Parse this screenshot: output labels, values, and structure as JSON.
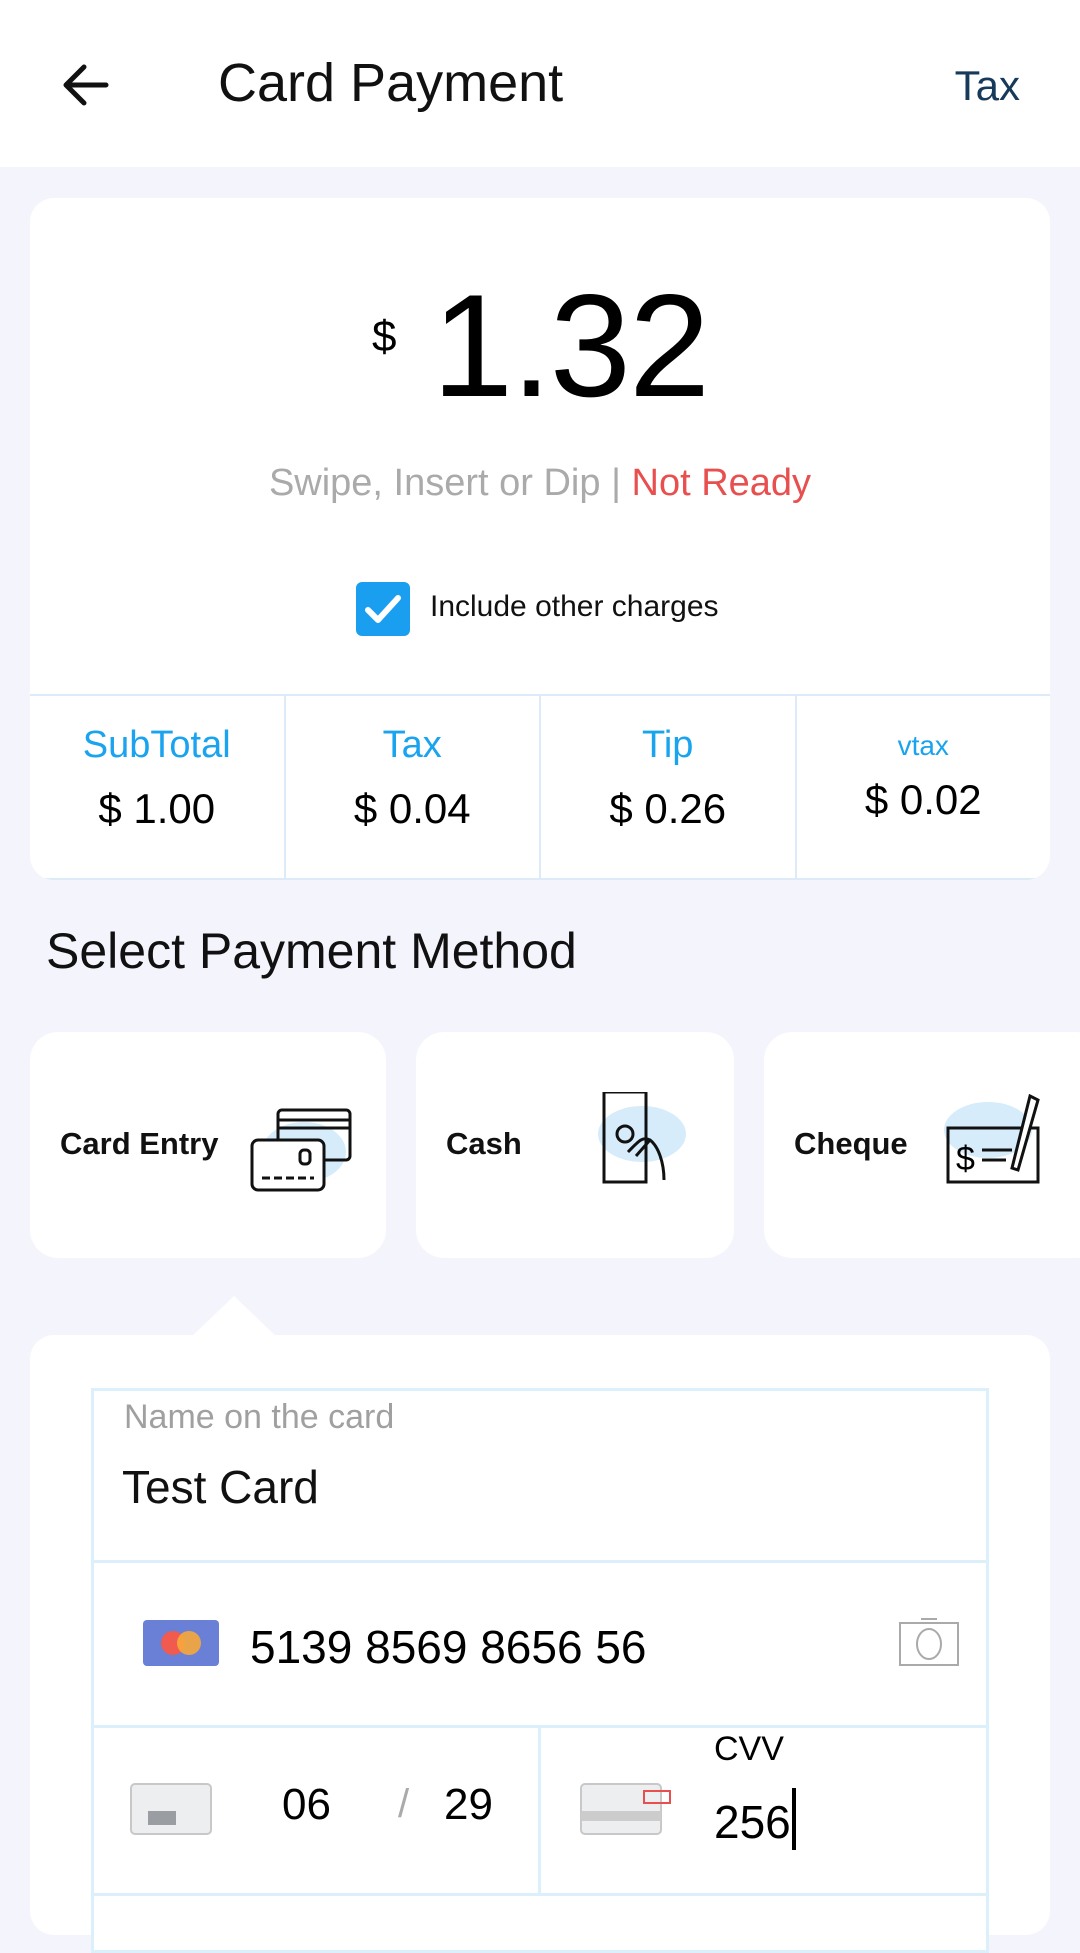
{
  "header": {
    "title": "Card Payment",
    "back_icon": "arrow-left-icon",
    "tax_link": "Tax"
  },
  "summary": {
    "currency": "$",
    "amount": "1.32",
    "status_prompt": "Swipe, Insert or Dip |",
    "status_state": "Not Ready",
    "status_color": "#e8504f",
    "include_other_charges": {
      "label": "Include other charges",
      "checked": true
    },
    "breakdown": [
      {
        "label": "SubTotal",
        "value": "$ 1.00"
      },
      {
        "label": "Tax",
        "value": "$ 0.04"
      },
      {
        "label": "Tip",
        "value": "$ 0.26"
      },
      {
        "label": "vtax",
        "value": "$ 0.02"
      }
    ]
  },
  "payment": {
    "section_title": "Select Payment Method",
    "methods": [
      {
        "label": "Card Entry",
        "icon": "credit-card-icon",
        "selected": true
      },
      {
        "label": "Cash",
        "icon": "cash-hand-icon"
      },
      {
        "label": "Cheque",
        "icon": "cheque-icon"
      }
    ]
  },
  "form": {
    "name_label": "Name on the card",
    "name_value": "Test Card",
    "card_number": "5139 8569 8656 56",
    "card_brand_icon": "mastercard-icon",
    "scan_icon": "camera-icon",
    "exp_month": "06",
    "exp_separator": "/",
    "exp_year": "29",
    "cvv_label": "CVV",
    "cvv_value": "256"
  },
  "colors": {
    "accent": "#1aa3ee",
    "background": "#f4f4fc",
    "header_link": "#17395a"
  }
}
